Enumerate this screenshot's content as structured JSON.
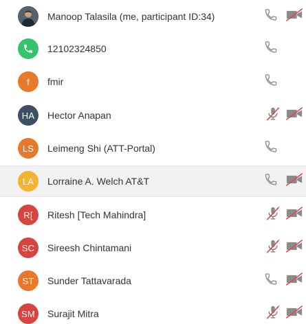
{
  "colors": {
    "text": "#333333",
    "icon_gray": "#8a8a8a",
    "muted_red": "#e0484f",
    "highlight_bg": "#f2f2f2"
  },
  "participants": [
    {
      "name": "Manoop Talasila (me, participant ID:34)",
      "initials": "",
      "avatar": "photo",
      "avatar_color": "#3a4a56",
      "audio": "phone",
      "video": "cam-off",
      "highlighted": false
    },
    {
      "name": "12102324850",
      "initials": "",
      "avatar": "phone",
      "avatar_color": "#34c46a",
      "audio": "phone",
      "video": "none",
      "highlighted": false
    },
    {
      "name": "fmir",
      "initials": "f",
      "avatar": "initials",
      "avatar_color": "#e8782a",
      "audio": "phone",
      "video": "none",
      "highlighted": false
    },
    {
      "name": "Hector Anapan",
      "initials": "HA",
      "avatar": "initials",
      "avatar_color": "#3d5068",
      "audio": "mic-muted",
      "video": "cam-off",
      "highlighted": false
    },
    {
      "name": "Leimeng Shi (ATT-Portal)",
      "initials": "LS",
      "avatar": "initials",
      "avatar_color": "#e8782a",
      "audio": "phone",
      "video": "none",
      "highlighted": false
    },
    {
      "name": "Lorraine A. Welch AT&T",
      "initials": "LA",
      "avatar": "initials",
      "avatar_color": "#f5b42e",
      "audio": "phone",
      "video": "cam-off",
      "highlighted": true
    },
    {
      "name": "Ritesh [Tech Mahindra]",
      "initials": "R[",
      "avatar": "initials",
      "avatar_color": "#d8453e",
      "audio": "mic-muted",
      "video": "cam-off",
      "highlighted": false
    },
    {
      "name": "Sireesh Chintamani",
      "initials": "SC",
      "avatar": "initials",
      "avatar_color": "#d8453e",
      "audio": "mic-muted",
      "video": "cam-off",
      "highlighted": false
    },
    {
      "name": "Sunder Tattavarada",
      "initials": "ST",
      "avatar": "initials",
      "avatar_color": "#e8782a",
      "audio": "phone",
      "video": "cam-off",
      "highlighted": false
    },
    {
      "name": "Surajit Mitra",
      "initials": "SM",
      "avatar": "initials",
      "avatar_color": "#d8453e",
      "audio": "mic-muted",
      "video": "cam-off",
      "highlighted": false
    }
  ]
}
